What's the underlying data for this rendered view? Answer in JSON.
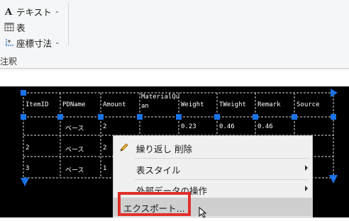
{
  "ribbon": {
    "text_label": "テキスト",
    "table_label": "表",
    "coord_dim_label": "座標寸法",
    "group_label": "注釈"
  },
  "table": {
    "headers": [
      "ItemID",
      "PDName",
      "Amount",
      "MaterialQu\nan",
      "Weight",
      "TWeight",
      "Remark",
      "Source"
    ],
    "rows": [
      [
        "",
        "ベース",
        "2",
        "",
        "0.23",
        "0.46",
        "0.46",
        ""
      ],
      [
        "2",
        "ベース",
        "2",
        "",
        "",
        "",
        "",
        ""
      ],
      [
        "3",
        "ベース",
        "1",
        "",
        "",
        "",
        "",
        ""
      ]
    ]
  },
  "context_menu": {
    "items": [
      {
        "label": "繰り返し 削除",
        "has_submenu": false
      },
      {
        "label": "表スタイル",
        "has_submenu": true
      },
      {
        "label": "外部データの操作",
        "has_submenu": true
      },
      {
        "label": "エクスポート...",
        "has_submenu": false
      }
    ]
  },
  "colors": {
    "canvas_bg": "#000000",
    "grip": "#1a73e8",
    "highlight_box": "#e0302b",
    "menu_bg": "#f0f0f0"
  }
}
